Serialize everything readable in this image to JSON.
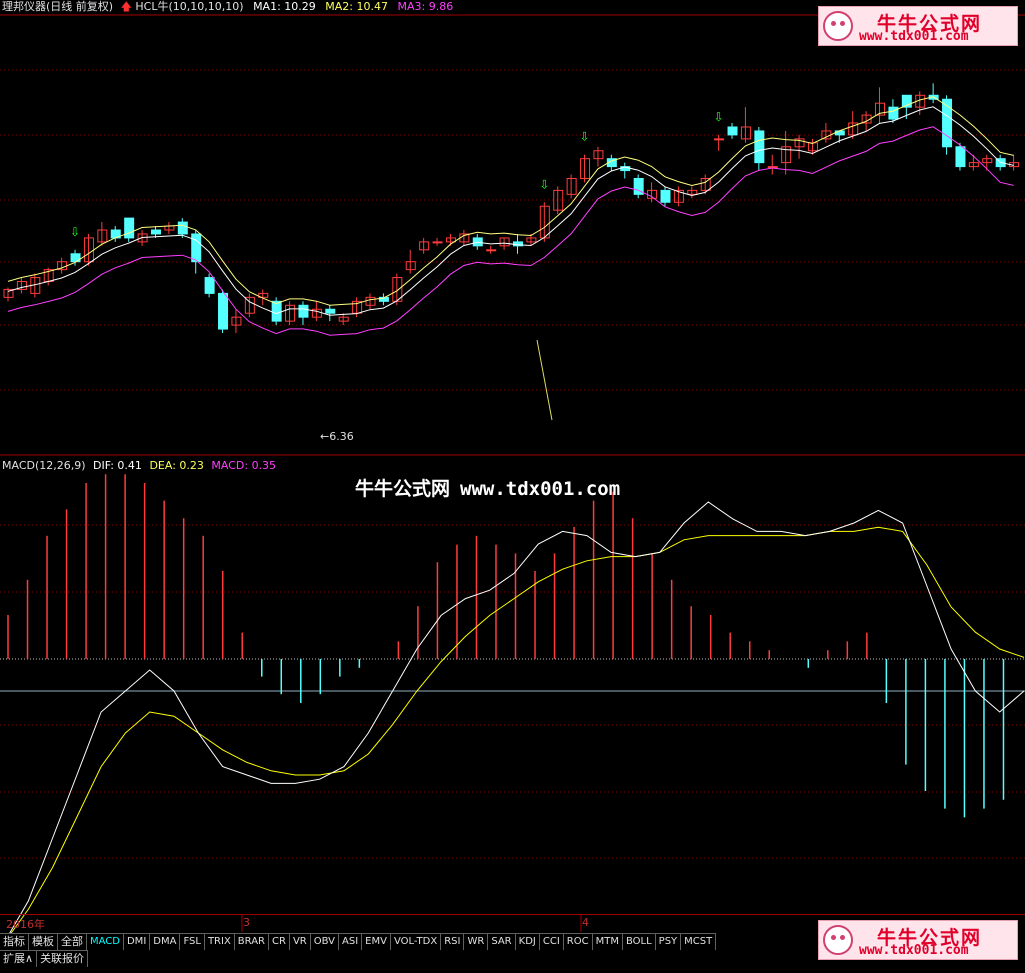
{
  "header": {
    "stock_name": "理邦仪器(日线 前复权)",
    "indicator_name": "HCL牛(10,10,10,10)",
    "ma1": "MA1: 10.29",
    "ma2": "MA2: 10.47",
    "ma3": "MA3: 9.86",
    "low_marker": "6.36"
  },
  "macd_header": {
    "label": "MACD(12,26,9)",
    "dif": "DIF: 0.41",
    "dea": "DEA: 0.23",
    "macd": "MACD: 0.35"
  },
  "watermark": {
    "title": "牛牛公式网",
    "url": "www.tdx001.com"
  },
  "logo": {
    "title": "牛牛公式网",
    "url": "www.tdx001.com"
  },
  "dates": [
    "2016年",
    "3",
    "4"
  ],
  "tabs": [
    "指标",
    "模板",
    "全部",
    "MACD",
    "DMI",
    "DMA",
    "FSL",
    "TRIX",
    "BRAR",
    "CR",
    "VR",
    "OBV",
    "ASI",
    "EMV",
    "VOL-TDX",
    "RSI",
    "WR",
    "SAR",
    "KDJ",
    "CCI",
    "ROC",
    "MTM",
    "BOLL",
    "PSY",
    "MCST"
  ],
  "active_tab": "MACD",
  "tabs2": [
    "扩展∧",
    "关联报价"
  ],
  "colors": {
    "up": "#ff3c3c",
    "down": "#54ffff",
    "ma1": "#ffffff",
    "ma2": "#ffff80",
    "ma3": "#ff40ff",
    "dif": "#ffffff",
    "dea": "#ffff00",
    "grid": "#800000"
  },
  "chart_data": {
    "type": "candlestick",
    "price_candles": [
      [
        9.6,
        9.8,
        9.5,
        9.85
      ],
      [
        9.8,
        10.0,
        9.7,
        10.1
      ],
      [
        9.7,
        10.1,
        9.6,
        10.2
      ],
      [
        10.0,
        10.3,
        9.9,
        10.35
      ],
      [
        10.3,
        10.5,
        10.2,
        10.6
      ],
      [
        10.7,
        10.5,
        10.4,
        10.8
      ],
      [
        10.5,
        11.1,
        10.4,
        11.2
      ],
      [
        11.0,
        11.3,
        10.9,
        11.5
      ],
      [
        11.3,
        11.1,
        11.0,
        11.4
      ],
      [
        11.6,
        11.1,
        11.0,
        11.6
      ],
      [
        11.0,
        11.2,
        10.9,
        11.3
      ],
      [
        11.3,
        11.2,
        11.1,
        11.4
      ],
      [
        11.3,
        11.4,
        11.2,
        11.5
      ],
      [
        11.5,
        11.2,
        11.1,
        11.6
      ],
      [
        11.2,
        10.5,
        10.2,
        11.3
      ],
      [
        10.1,
        9.7,
        9.6,
        10.2
      ],
      [
        9.7,
        8.8,
        8.7,
        9.8
      ],
      [
        8.9,
        9.1,
        8.7,
        9.3
      ],
      [
        9.2,
        9.6,
        9.1,
        9.7
      ],
      [
        9.6,
        9.7,
        9.4,
        9.8
      ],
      [
        9.5,
        9.0,
        8.9,
        9.6
      ],
      [
        9.0,
        9.4,
        8.9,
        9.5
      ],
      [
        9.4,
        9.1,
        8.9,
        9.5
      ],
      [
        9.1,
        9.3,
        9.0,
        9.5
      ],
      [
        9.3,
        9.2,
        9.0,
        9.4
      ],
      [
        9.0,
        9.1,
        8.9,
        9.2
      ],
      [
        9.2,
        9.5,
        9.1,
        9.6
      ],
      [
        9.4,
        9.6,
        9.3,
        9.7
      ],
      [
        9.6,
        9.5,
        9.4,
        9.7
      ],
      [
        9.5,
        10.1,
        9.4,
        10.2
      ],
      [
        10.3,
        10.5,
        10.2,
        10.8
      ],
      [
        10.8,
        11.0,
        10.7,
        11.1
      ],
      [
        11.0,
        11.0,
        10.9,
        11.1
      ],
      [
        11.0,
        11.1,
        10.9,
        11.2
      ],
      [
        11.0,
        11.2,
        10.9,
        11.3
      ],
      [
        11.1,
        10.9,
        10.8,
        11.2
      ],
      [
        10.8,
        10.8,
        10.7,
        10.9
      ],
      [
        10.9,
        11.1,
        10.8,
        11.1
      ],
      [
        11.0,
        10.9,
        10.7,
        11.2
      ],
      [
        11.0,
        11.1,
        10.9,
        11.2
      ],
      [
        11.1,
        11.9,
        11.0,
        12.0
      ],
      [
        11.8,
        12.3,
        11.7,
        12.4
      ],
      [
        12.2,
        12.6,
        12.1,
        12.7
      ],
      [
        12.6,
        13.1,
        12.5,
        13.2
      ],
      [
        13.1,
        13.3,
        12.9,
        13.4
      ],
      [
        13.1,
        12.9,
        12.8,
        13.2
      ],
      [
        12.9,
        12.8,
        12.6,
        13.0
      ],
      [
        12.6,
        12.2,
        12.1,
        12.7
      ],
      [
        12.1,
        12.3,
        12.0,
        12.5
      ],
      [
        12.3,
        12.0,
        11.9,
        12.4
      ],
      [
        12.0,
        12.3,
        11.9,
        12.4
      ],
      [
        12.2,
        12.3,
        12.1,
        12.4
      ],
      [
        12.3,
        12.6,
        12.2,
        12.7
      ],
      [
        13.6,
        13.6,
        13.3,
        13.7
      ],
      [
        13.9,
        13.7,
        13.6,
        14.0
      ],
      [
        13.6,
        13.9,
        13.5,
        14.4
      ],
      [
        13.8,
        13.0,
        12.8,
        13.9
      ],
      [
        12.9,
        12.9,
        12.7,
        13.2
      ],
      [
        13.0,
        13.4,
        12.7,
        13.8
      ],
      [
        13.4,
        13.6,
        13.1,
        13.7
      ],
      [
        13.3,
        13.5,
        13.2,
        13.6
      ],
      [
        13.6,
        13.8,
        13.5,
        14.0
      ],
      [
        13.8,
        13.7,
        13.5,
        13.8
      ],
      [
        13.7,
        14.0,
        13.6,
        14.3
      ],
      [
        14.0,
        14.2,
        13.8,
        14.3
      ],
      [
        14.2,
        14.5,
        14.0,
        14.9
      ],
      [
        14.4,
        14.1,
        14.0,
        14.6
      ],
      [
        14.7,
        14.4,
        14.1,
        14.7
      ],
      [
        14.4,
        14.7,
        14.2,
        14.8
      ],
      [
        14.7,
        14.6,
        14.5,
        15.0
      ],
      [
        14.6,
        13.4,
        13.2,
        14.7
      ],
      [
        13.4,
        12.9,
        12.8,
        13.5
      ],
      [
        12.9,
        13.0,
        12.8,
        13.2
      ],
      [
        13.0,
        13.1,
        12.8,
        13.2
      ],
      [
        13.1,
        12.9,
        12.8,
        13.2
      ],
      [
        12.9,
        13.0,
        12.8,
        13.2
      ]
    ],
    "macd_histogram": [
      0.05,
      0.09,
      0.14,
      0.17,
      0.2,
      0.21,
      0.21,
      0.2,
      0.18,
      0.16,
      0.14,
      0.1,
      0.03,
      -0.02,
      -0.04,
      -0.05,
      -0.04,
      -0.02,
      -0.01,
      0.0,
      0.02,
      0.06,
      0.11,
      0.13,
      0.14,
      0.13,
      0.12,
      0.1,
      0.12,
      0.15,
      0.18,
      0.19,
      0.16,
      0.12,
      0.09,
      0.06,
      0.05,
      0.03,
      0.02,
      0.01,
      0.0,
      -0.01,
      0.01,
      0.02,
      0.03,
      -0.05,
      -0.12,
      -0.15,
      -0.17,
      -0.18,
      -0.17,
      -0.16
    ],
    "dif": [
      -0.6,
      -0.5,
      -0.35,
      -0.2,
      -0.05,
      0.0,
      0.05,
      0.0,
      -0.1,
      -0.18,
      -0.2,
      -0.22,
      -0.22,
      -0.21,
      -0.18,
      -0.1,
      0.0,
      0.1,
      0.18,
      0.22,
      0.24,
      0.28,
      0.35,
      0.38,
      0.37,
      0.33,
      0.32,
      0.33,
      0.4,
      0.45,
      0.41,
      0.38,
      0.38,
      0.37,
      0.38,
      0.4,
      0.43,
      0.4,
      0.25,
      0.1,
      0.0,
      -0.05,
      0.0
    ],
    "dea": [
      -0.6,
      -0.52,
      -0.42,
      -0.3,
      -0.18,
      -0.1,
      -0.05,
      -0.06,
      -0.1,
      -0.14,
      -0.17,
      -0.19,
      -0.2,
      -0.2,
      -0.19,
      -0.15,
      -0.08,
      0.0,
      0.07,
      0.13,
      0.18,
      0.22,
      0.26,
      0.29,
      0.31,
      0.32,
      0.32,
      0.33,
      0.36,
      0.37,
      0.37,
      0.37,
      0.37,
      0.37,
      0.38,
      0.38,
      0.39,
      0.38,
      0.3,
      0.2,
      0.14,
      0.1,
      0.08
    ]
  }
}
